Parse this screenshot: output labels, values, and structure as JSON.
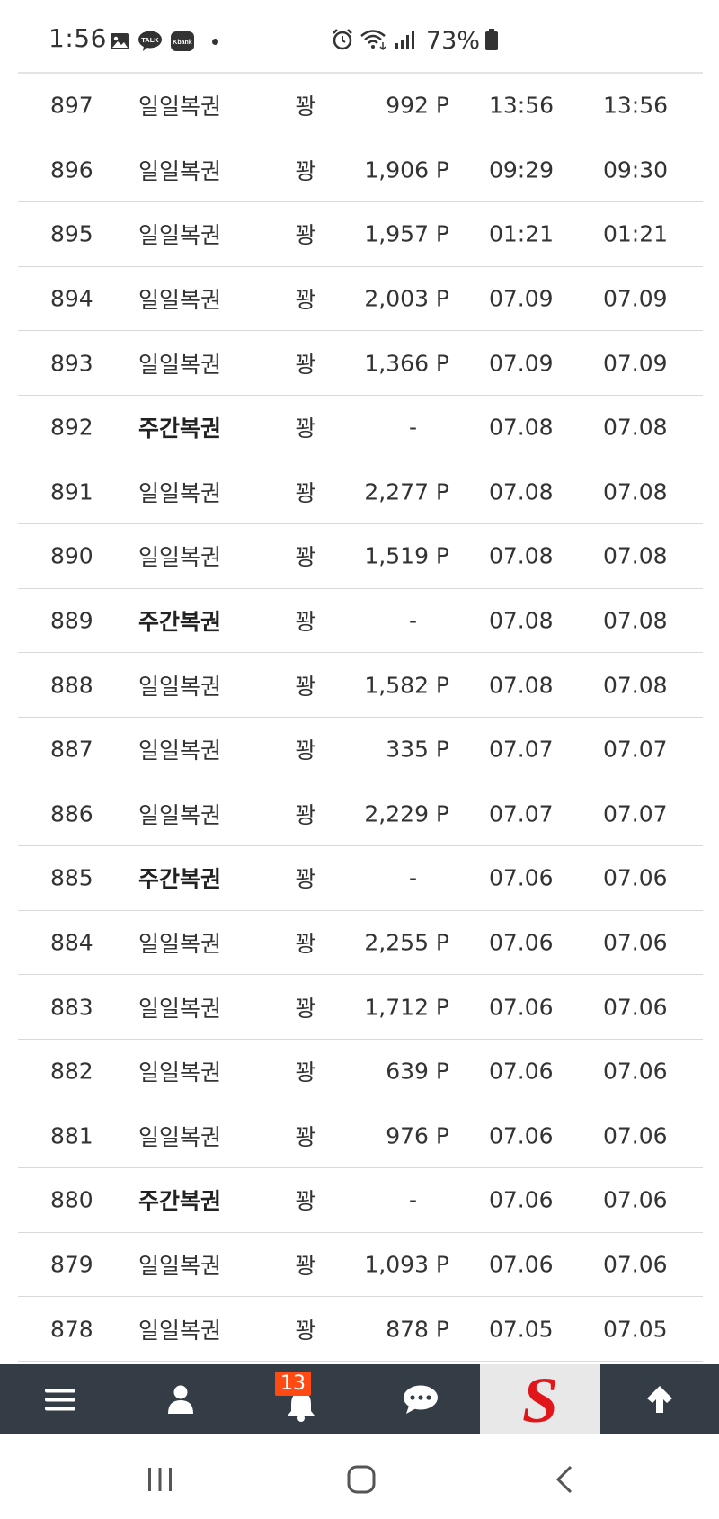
{
  "status_bar": {
    "time": "1:56",
    "notification_icons": [
      "gallery-icon",
      "kakaotalk-icon",
      "kbank-icon",
      "more-dot-icon"
    ],
    "talk_label": "TALK",
    "kbank_label": "Kbank",
    "system_icons": [
      "alarm-icon",
      "wifi-icon",
      "signal-icon"
    ],
    "battery": "73%"
  },
  "rows": [
    {
      "no": "897",
      "type": "일일복권",
      "bold": false,
      "result": "꽝",
      "points": "992 P",
      "start": "13:56",
      "end": "13:56"
    },
    {
      "no": "896",
      "type": "일일복권",
      "bold": false,
      "result": "꽝",
      "points": "1,906 P",
      "start": "09:29",
      "end": "09:30"
    },
    {
      "no": "895",
      "type": "일일복권",
      "bold": false,
      "result": "꽝",
      "points": "1,957 P",
      "start": "01:21",
      "end": "01:21"
    },
    {
      "no": "894",
      "type": "일일복권",
      "bold": false,
      "result": "꽝",
      "points": "2,003 P",
      "start": "07.09",
      "end": "07.09"
    },
    {
      "no": "893",
      "type": "일일복권",
      "bold": false,
      "result": "꽝",
      "points": "1,366 P",
      "start": "07.09",
      "end": "07.09"
    },
    {
      "no": "892",
      "type": "주간복권",
      "bold": true,
      "result": "꽝",
      "points": "-",
      "start": "07.08",
      "end": "07.08"
    },
    {
      "no": "891",
      "type": "일일복권",
      "bold": false,
      "result": "꽝",
      "points": "2,277 P",
      "start": "07.08",
      "end": "07.08"
    },
    {
      "no": "890",
      "type": "일일복권",
      "bold": false,
      "result": "꽝",
      "points": "1,519 P",
      "start": "07.08",
      "end": "07.08"
    },
    {
      "no": "889",
      "type": "주간복권",
      "bold": true,
      "result": "꽝",
      "points": "-",
      "start": "07.08",
      "end": "07.08"
    },
    {
      "no": "888",
      "type": "일일복권",
      "bold": false,
      "result": "꽝",
      "points": "1,582 P",
      "start": "07.08",
      "end": "07.08"
    },
    {
      "no": "887",
      "type": "일일복권",
      "bold": false,
      "result": "꽝",
      "points": "335 P",
      "start": "07.07",
      "end": "07.07"
    },
    {
      "no": "886",
      "type": "일일복권",
      "bold": false,
      "result": "꽝",
      "points": "2,229 P",
      "start": "07.07",
      "end": "07.07"
    },
    {
      "no": "885",
      "type": "주간복권",
      "bold": true,
      "result": "꽝",
      "points": "-",
      "start": "07.06",
      "end": "07.06"
    },
    {
      "no": "884",
      "type": "일일복권",
      "bold": false,
      "result": "꽝",
      "points": "2,255 P",
      "start": "07.06",
      "end": "07.06"
    },
    {
      "no": "883",
      "type": "일일복권",
      "bold": false,
      "result": "꽝",
      "points": "1,712 P",
      "start": "07.06",
      "end": "07.06"
    },
    {
      "no": "882",
      "type": "일일복권",
      "bold": false,
      "result": "꽝",
      "points": "639 P",
      "start": "07.06",
      "end": "07.06"
    },
    {
      "no": "881",
      "type": "일일복권",
      "bold": false,
      "result": "꽝",
      "points": "976 P",
      "start": "07.06",
      "end": "07.06"
    },
    {
      "no": "880",
      "type": "주간복권",
      "bold": true,
      "result": "꽝",
      "points": "-",
      "start": "07.06",
      "end": "07.06"
    },
    {
      "no": "879",
      "type": "일일복권",
      "bold": false,
      "result": "꽝",
      "points": "1,093 P",
      "start": "07.06",
      "end": "07.06"
    },
    {
      "no": "878",
      "type": "일일복권",
      "bold": false,
      "result": "꽝",
      "points": "878 P",
      "start": "07.05",
      "end": "07.05"
    }
  ],
  "bottom_nav": {
    "items": [
      "menu-icon",
      "user-icon",
      "bell-icon",
      "chat-icon",
      "site-logo",
      "arrow-up-icon"
    ],
    "notification_count": "13",
    "logo_letter": "S",
    "logo_color": "#e0161b",
    "background": "#343c45"
  },
  "system_nav": {
    "items": [
      "recent-apps-icon",
      "home-icon",
      "back-icon"
    ]
  }
}
